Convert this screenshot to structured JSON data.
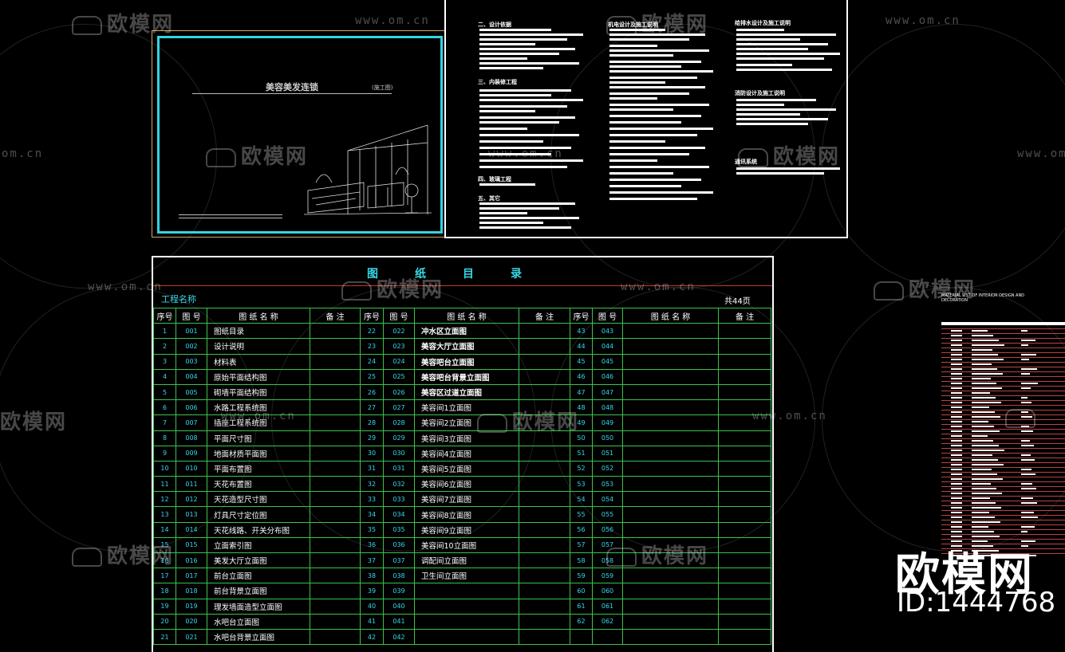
{
  "watermark": {
    "brand": "欧模网",
    "url": "www.om.cn",
    "url_short": "om.cn"
  },
  "cover": {
    "title": "美容美发连锁",
    "tag": "(施工图)"
  },
  "notes": {
    "headings": [
      "二、设计依据",
      "三、内装修工程",
      "四、玻璃工程",
      "五、其它",
      "机电设计及施工说明",
      "给排水设计及施工说明",
      "消防设计及施工说明",
      "通讯系统"
    ]
  },
  "index": {
    "title": "图纸目录",
    "project_label": "工程名称",
    "total_pages": "共44页",
    "headers": [
      "序号",
      "图 号",
      "图 纸 名 称",
      "备 注"
    ],
    "col1": [
      {
        "n": "1",
        "c": "001",
        "t": "图纸目录"
      },
      {
        "n": "2",
        "c": "002",
        "t": "设计说明"
      },
      {
        "n": "3",
        "c": "003",
        "t": "材料表"
      },
      {
        "n": "4",
        "c": "004",
        "t": "原始平面结构图"
      },
      {
        "n": "5",
        "c": "005",
        "t": "砌墙平面结构图"
      },
      {
        "n": "6",
        "c": "006",
        "t": "水路工程系统图"
      },
      {
        "n": "7",
        "c": "007",
        "t": "插座工程系统图"
      },
      {
        "n": "8",
        "c": "008",
        "t": "平面尺寸图"
      },
      {
        "n": "9",
        "c": "009",
        "t": "地面材质平面图"
      },
      {
        "n": "10",
        "c": "010",
        "t": "平面布置图"
      },
      {
        "n": "11",
        "c": "011",
        "t": "天花布置图"
      },
      {
        "n": "12",
        "c": "012",
        "t": "天花造型尺寸图"
      },
      {
        "n": "13",
        "c": "013",
        "t": "灯具尺寸定位图"
      },
      {
        "n": "14",
        "c": "014",
        "t": "天花线路、开关分布图"
      },
      {
        "n": "15",
        "c": "015",
        "t": "立面索引图"
      },
      {
        "n": "16",
        "c": "016",
        "t": "美发大厅立面图"
      },
      {
        "n": "17",
        "c": "017",
        "t": "前台立面图"
      },
      {
        "n": "18",
        "c": "018",
        "t": "前台背景立面图"
      },
      {
        "n": "19",
        "c": "019",
        "t": "理发墙面造型立面图"
      },
      {
        "n": "20",
        "c": "020",
        "t": "水吧台立面图"
      },
      {
        "n": "21",
        "c": "021",
        "t": "水吧台背景立面图"
      }
    ],
    "col2": [
      {
        "n": "22",
        "c": "022",
        "t": "冲水区立面图",
        "b": true
      },
      {
        "n": "23",
        "c": "023",
        "t": "美容大厅立面图",
        "b": true
      },
      {
        "n": "24",
        "c": "024",
        "t": "美容吧台立面图",
        "b": true
      },
      {
        "n": "25",
        "c": "025",
        "t": "美容吧台背景立面图",
        "b": true
      },
      {
        "n": "26",
        "c": "026",
        "t": "美容区过道立面图",
        "b": true
      },
      {
        "n": "27",
        "c": "027",
        "t": "美容间1立面图"
      },
      {
        "n": "28",
        "c": "028",
        "t": "美容间2立面图"
      },
      {
        "n": "29",
        "c": "029",
        "t": "美容间3立面图"
      },
      {
        "n": "30",
        "c": "030",
        "t": "美容间4立面图"
      },
      {
        "n": "31",
        "c": "031",
        "t": "美容间5立面图"
      },
      {
        "n": "32",
        "c": "032",
        "t": "美容间6立面图"
      },
      {
        "n": "33",
        "c": "033",
        "t": "美容间7立面图"
      },
      {
        "n": "34",
        "c": "034",
        "t": "美容间8立面图"
      },
      {
        "n": "35",
        "c": "035",
        "t": "美容间9立面图"
      },
      {
        "n": "36",
        "c": "036",
        "t": "美容间10立面图"
      },
      {
        "n": "37",
        "c": "037",
        "t": "调配间立面图"
      },
      {
        "n": "38",
        "c": "038",
        "t": "卫生间立面图"
      },
      {
        "n": "39",
        "c": "039",
        "t": ""
      },
      {
        "n": "40",
        "c": "040",
        "t": ""
      },
      {
        "n": "41",
        "c": "041",
        "t": ""
      },
      {
        "n": "42",
        "c": "042",
        "t": ""
      }
    ],
    "col3": [
      {
        "n": "43",
        "c": "043"
      },
      {
        "n": "44",
        "c": "044"
      },
      {
        "n": "45",
        "c": "045"
      },
      {
        "n": "46",
        "c": "046"
      },
      {
        "n": "47",
        "c": "047"
      },
      {
        "n": "48",
        "c": "048"
      },
      {
        "n": "49",
        "c": "049"
      },
      {
        "n": "50",
        "c": "050"
      },
      {
        "n": "51",
        "c": "051"
      },
      {
        "n": "52",
        "c": "052"
      },
      {
        "n": "53",
        "c": "053"
      },
      {
        "n": "54",
        "c": "054"
      },
      {
        "n": "55",
        "c": "055"
      },
      {
        "n": "56",
        "c": "056"
      },
      {
        "n": "57",
        "c": "057"
      },
      {
        "n": "58",
        "c": "058"
      },
      {
        "n": "59",
        "c": "059"
      },
      {
        "n": "60",
        "c": "060"
      },
      {
        "n": "61",
        "c": "061"
      },
      {
        "n": "62",
        "c": "062"
      }
    ]
  },
  "material": {
    "title": "MATERIAL LIST OF INTERIOR DESIGN AND DECORATION"
  },
  "badge": {
    "brand": "欧模网",
    "id": "ID:1444768"
  }
}
